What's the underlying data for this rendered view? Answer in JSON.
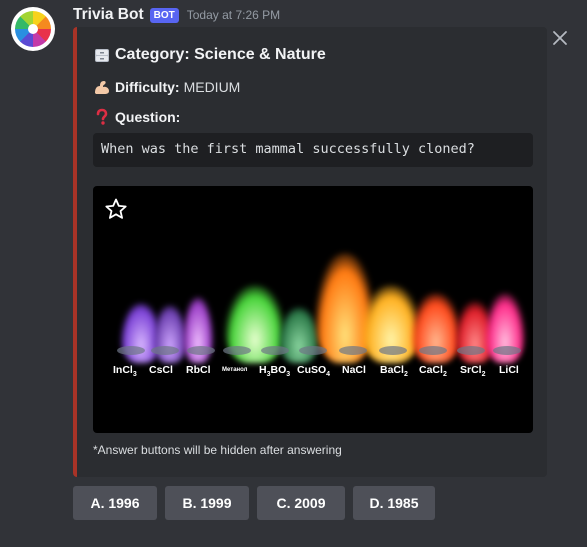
{
  "message": {
    "username": "Trivia Bot",
    "bot_tag": "BOT",
    "timestamp": "Today at 7:26 PM"
  },
  "embed": {
    "accent_color": "#a83327",
    "category_label": "Category: Science & Nature",
    "difficulty_label": "Difficulty:",
    "difficulty_value": "MEDIUM",
    "question_label": "Question:",
    "question_text": "When was the first mammal successfully cloned?",
    "image": {
      "description_icons": [
        "star-icon"
      ],
      "compound_labels": [
        {
          "base": "InCl",
          "sub": "3"
        },
        {
          "base": "CsCl",
          "sub": ""
        },
        {
          "base": "RbCl",
          "sub": ""
        },
        {
          "base": "Метанол",
          "sub": ""
        },
        {
          "base": "H",
          "sub": "3",
          "rest": "BO",
          "sub2": "3"
        },
        {
          "base": "CuSO",
          "sub": "4"
        },
        {
          "base": "NaCl",
          "sub": ""
        },
        {
          "base": "BaCl",
          "sub": "2"
        },
        {
          "base": "CaCl",
          "sub": "2"
        },
        {
          "base": "SrCl",
          "sub": "2"
        },
        {
          "base": "LiCl",
          "sub": ""
        }
      ]
    },
    "footer": "*Answer buttons will be hidden after answering"
  },
  "buttons": [
    {
      "label": "A. 1996"
    },
    {
      "label": "B. 1999"
    },
    {
      "label": "C. 2009"
    },
    {
      "label": "D. 1985"
    }
  ]
}
